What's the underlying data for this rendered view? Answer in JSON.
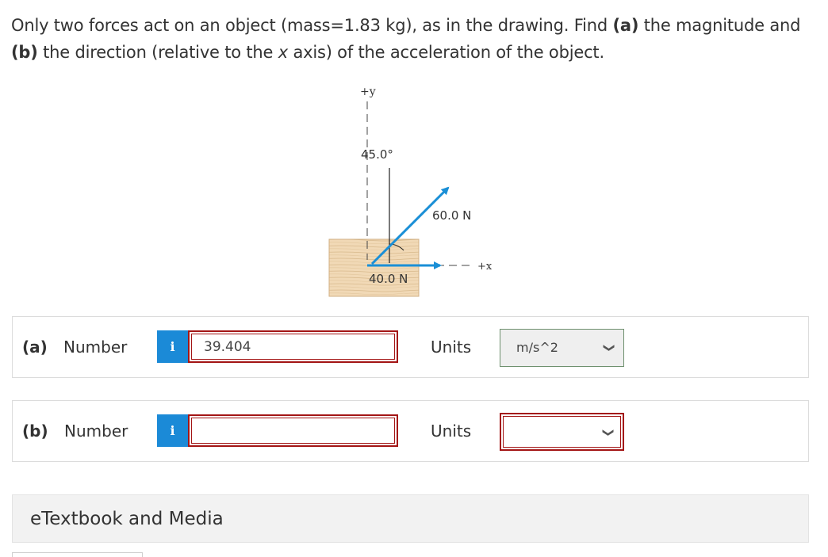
{
  "question": {
    "part1": "Only two forces act on an object (mass=1.83 kg), as in the drawing. Find ",
    "a_tag": "(a)",
    "part2": " the magnitude and ",
    "b_tag": "(b)",
    "part3": " the direction (relative to the ",
    "x_var": "x",
    "part4": " axis) of the acceleration of the object."
  },
  "figure": {
    "y_axis_label": "+y",
    "x_axis_label": "+x",
    "angle_label": "45.0°",
    "force1_label": "60.0 N",
    "force2_label": "40.0 N",
    "arrow_color": "#1a8fd6"
  },
  "answers": {
    "a": {
      "part": "(a)",
      "number_label": "Number",
      "info_icon": "i",
      "value": "39.404",
      "units_label": "Units",
      "units_value": "m/s^2"
    },
    "b": {
      "part": "(b)",
      "number_label": "Number",
      "info_icon": "i",
      "value": "",
      "units_label": "Units",
      "units_value": ""
    }
  },
  "etextbook": {
    "label": "eTextbook and Media"
  },
  "colors": {
    "info_blue": "#1b8ad7",
    "error_red": "#a31515"
  }
}
